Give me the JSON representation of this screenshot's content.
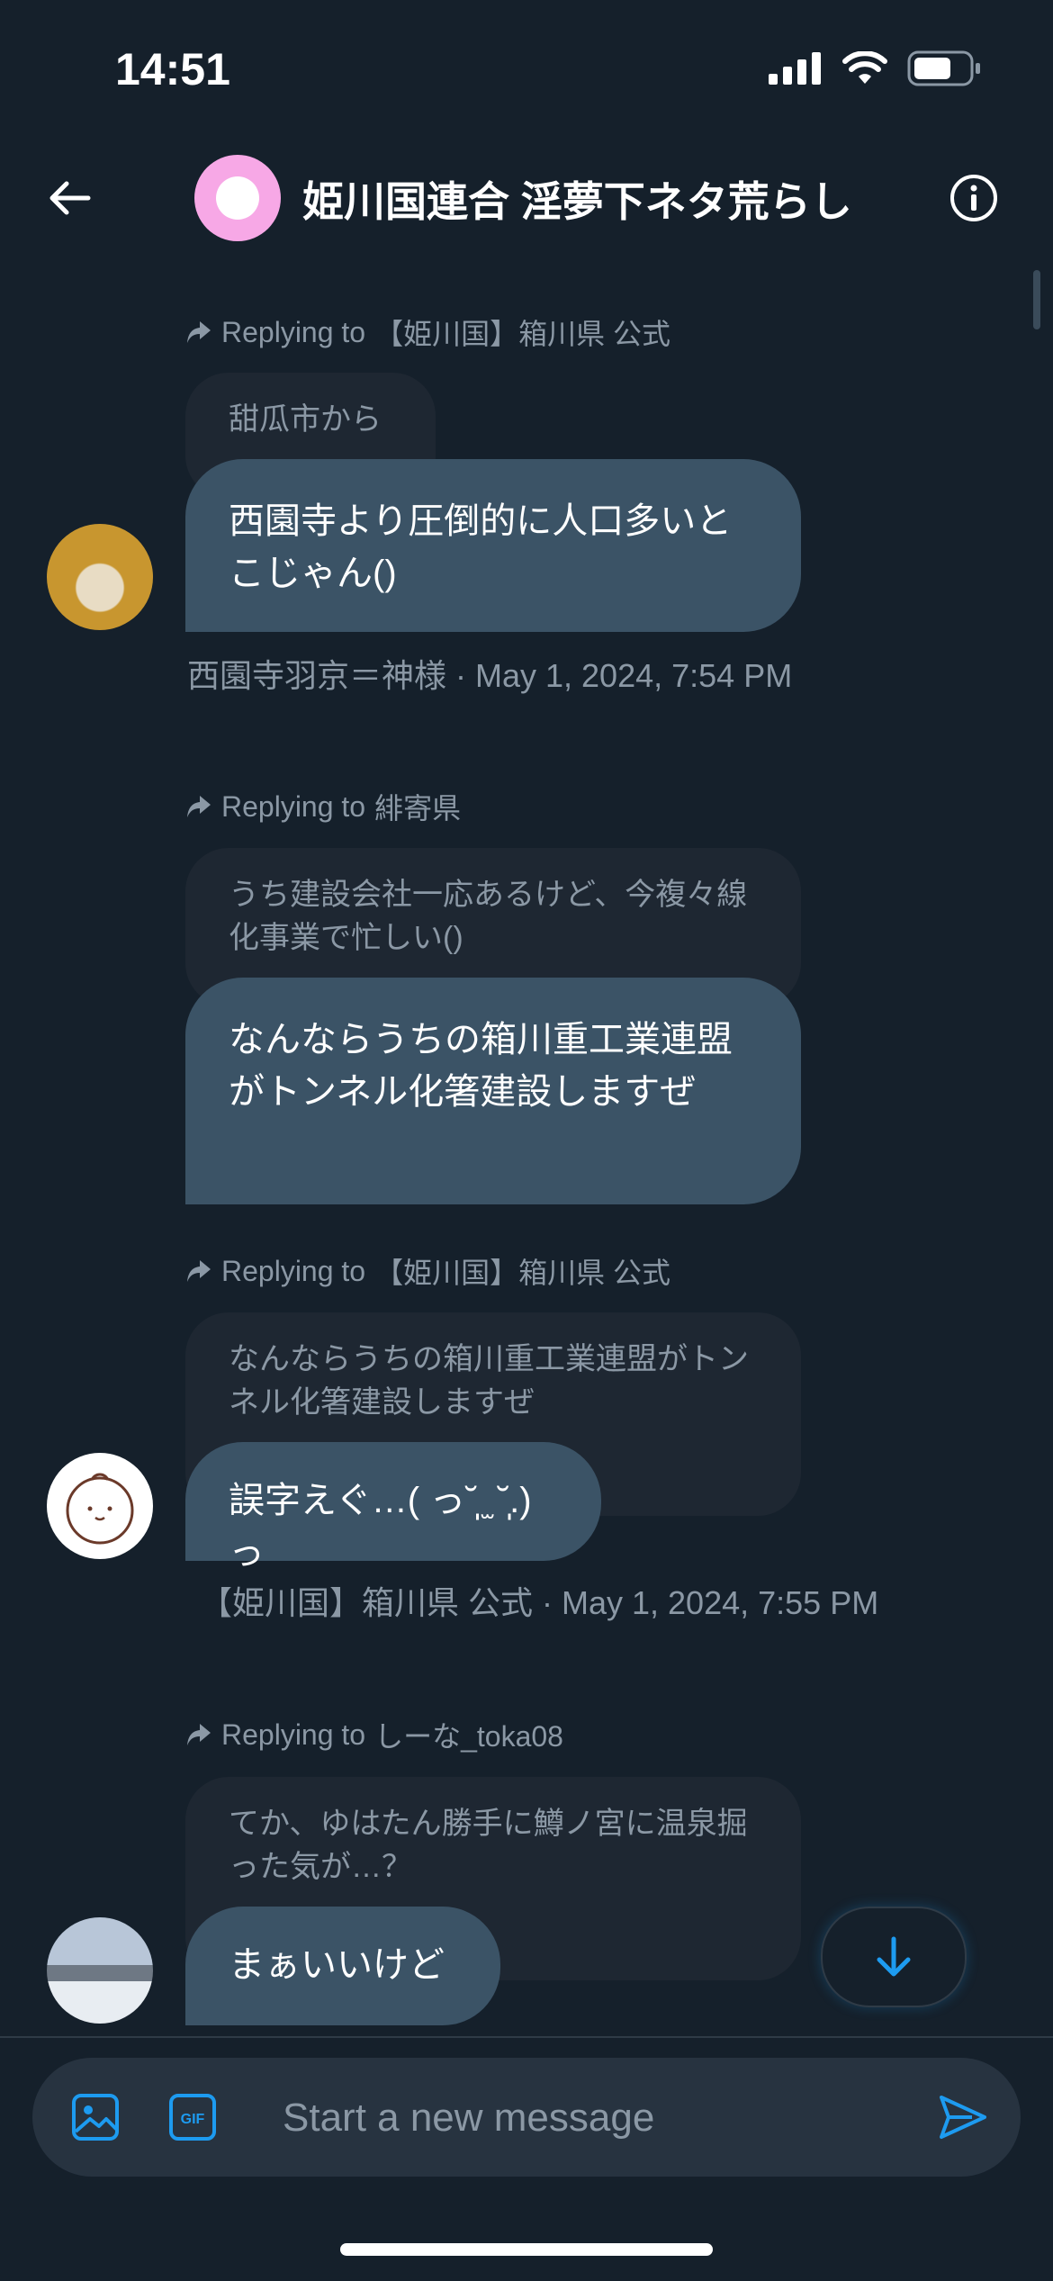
{
  "status": {
    "time": "14:51"
  },
  "header": {
    "title": "姫川国連合 淫夢下ネタ荒らし"
  },
  "messages": [
    {
      "replying_label": "Replying to",
      "replying_to": "【姫川国】箱川県 公式",
      "quote": "甜瓜市から",
      "text": "西園寺より圧倒的に人口多いとこじゃん()",
      "meta": "西園寺羽京＝神様 · May 1, 2024, 7:54 PM"
    },
    {
      "replying_label": "Replying to",
      "replying_to": "緋寄県",
      "quote": "うち建設会社一応あるけど、今複々線化事業で忙しい()",
      "text": "なんならうちの箱川重工業連盟がトンネル化箸建設しますぜ"
    },
    {
      "replying_label": "Replying to",
      "replying_to": "【姫川国】箱川県 公式",
      "quote": "なんならうちの箱川重工業連盟がトンネル化箸建設しますぜ",
      "text": "誤字えぐ…( っ˘̩̩̩̩̩ ̫ ˘̩̩̩̩̩.)っ",
      "meta": "【姫川国】箱川県 公式 · May 1, 2024, 7:55 PM"
    },
    {
      "replying_label": "Replying to",
      "replying_to": "しーな_toka08",
      "quote": "てか、ゆはたん勝手に鱒ノ宮に温泉掘った気が…？",
      "text": "まぁいいけど"
    }
  ],
  "composer": {
    "placeholder": "Start a new message"
  },
  "colors": {
    "background": "#15202b",
    "bubble": "#3b5366",
    "quote": "#1e2732",
    "accent": "#1d9bf0"
  }
}
